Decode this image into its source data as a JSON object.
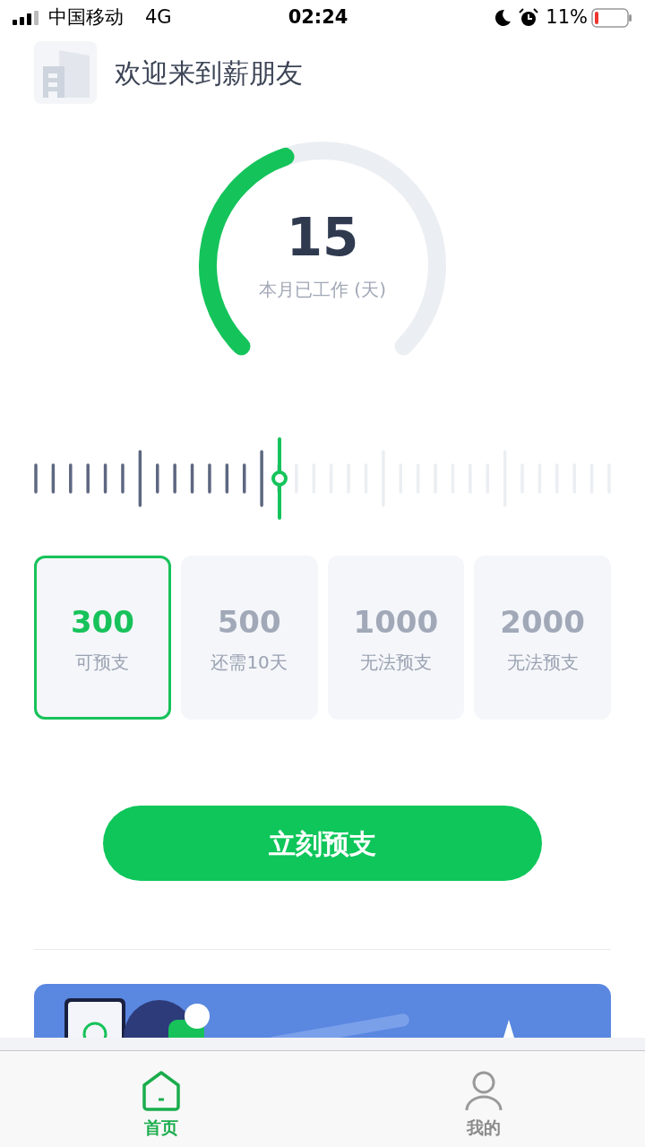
{
  "status_bar": {
    "carrier": "中国移动",
    "network": "4G",
    "time": "02:24",
    "battery": "11%"
  },
  "header": {
    "title": "欢迎来到薪朋友"
  },
  "gauge": {
    "value": "15",
    "caption": "本月已工作 (天)"
  },
  "ruler": {
    "level": 0.425
  },
  "options": [
    {
      "amount": "300",
      "note": "可预支",
      "selected": true
    },
    {
      "amount": "500",
      "note": "还需10天",
      "selected": false
    },
    {
      "amount": "1000",
      "note": "无法预支",
      "selected": false
    },
    {
      "amount": "2000",
      "note": "无法预支",
      "selected": false
    }
  ],
  "action_button": {
    "label": "立刻预支"
  },
  "tabs": [
    {
      "label": "首页",
      "kind": "home",
      "selected": true
    },
    {
      "label": "我的",
      "kind": "profile",
      "selected": false
    }
  ]
}
